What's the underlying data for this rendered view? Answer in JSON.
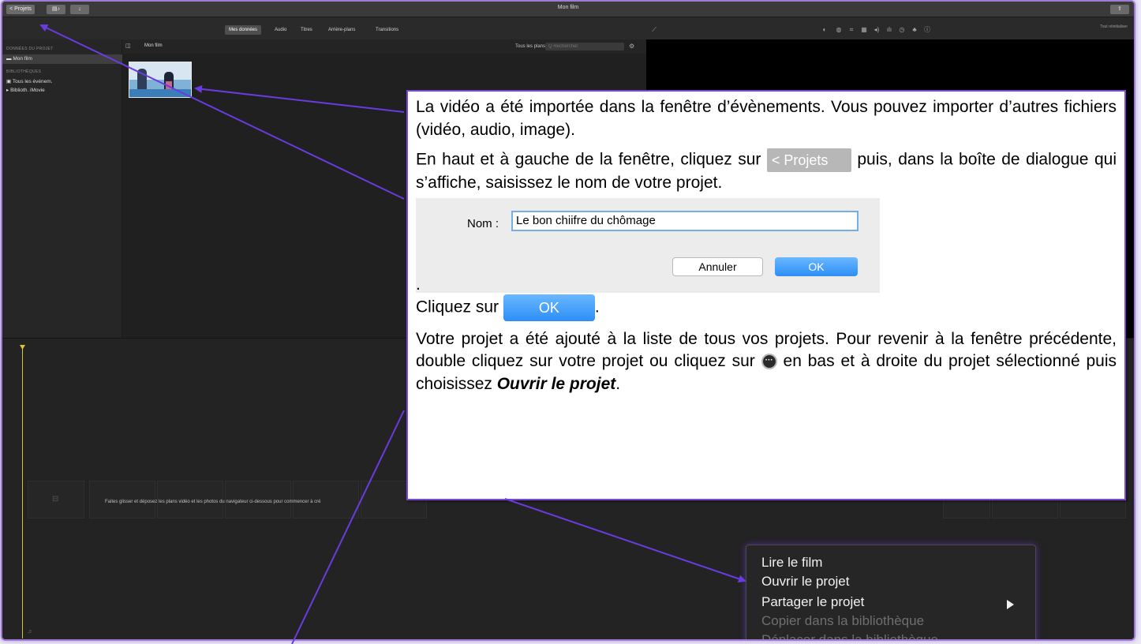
{
  "app": {
    "window_title": "Mon film",
    "back_button_label": "< Projets",
    "reset_label": "Tout réinitialiser"
  },
  "tabs": [
    "Mes données",
    "Audio",
    "Titres",
    "Arrière-plans",
    "Transitions"
  ],
  "sidebar": {
    "project_heading": "DONNÉES DU PROJET",
    "project_item": "Mon film",
    "libraries_heading": "BIBLIOTHÈQUES",
    "all_events": "Tous les événem.",
    "imovie_library": "▸ Biblioth. iMovie"
  },
  "browser": {
    "title": "Mon film",
    "filter": "Tous les plans ◇",
    "search_placeholder": "Q Rechercher"
  },
  "timeline": {
    "drop_hint": "Faites glisser et déposez les plans vidéo et les photos du navigateur ci-dessous pour commencer à cré"
  },
  "callout": {
    "para1": "La vidéo a été importée dans la fenêtre d’évènements. Vous pouvez importer d’autres fichiers (vidéo, audio, image).",
    "para2_before": "En haut et à gauche de la fenêtre, cliquez sur",
    "projets_button": "< Projets",
    "para2_after": "puis, dans la boîte de dialogue qui s’affiche, saisissez le nom de votre projet.",
    "dialog": {
      "name_label": "Nom :",
      "name_value": "Le bon chiifre du chômage",
      "cancel": "Annuler",
      "ok": "OK"
    },
    "dot": ".",
    "click_ok_before": "Cliquez sur",
    "ok_button": "OK",
    "click_ok_after": ".",
    "para4_before": "Votre projet a été ajouté à la liste de tous vos projets. Pour revenir à la fenêtre précédente, double cliquez sur votre projet ou cliquez sur",
    "para4_mid": "en bas et à droite du projet sélectionné puis choisissez",
    "para4_emph": "Ouvrir le projet",
    "para4_end": "."
  },
  "context_menu": {
    "items": [
      "Lire le film",
      "Ouvrir le projet",
      "Partager le projet",
      "Copier dans la bibliothèque",
      "Déplacer dans la bibliothèque"
    ]
  },
  "colors": {
    "callout_border": "#7b48d6",
    "arrow": "#6a3be0",
    "playhead": "#e3c02d",
    "ok_blue": "#2c8ef8"
  }
}
